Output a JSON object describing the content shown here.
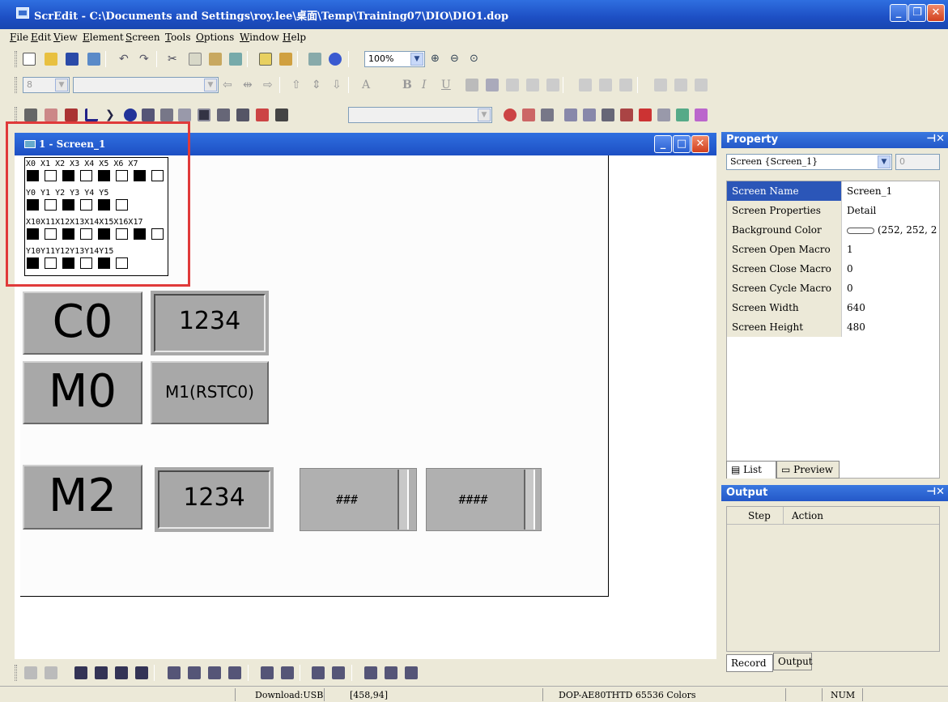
{
  "window": {
    "title": "ScrEdit - C:\\Documents and Settings\\roy.lee\\桌面\\Temp\\Training07\\DIO\\DIO1.dop"
  },
  "menu": [
    "File",
    "Edit",
    "View",
    "Element",
    "Screen",
    "Tools",
    "Options",
    "Window",
    "Help"
  ],
  "toolbar": {
    "zoom_value": "100%",
    "font_size_value": "8"
  },
  "child_window": {
    "title": "1 - Screen_1"
  },
  "io_panel": {
    "row1_labels": "X0 X1 X2 X3 X4 X5 X6 X7",
    "row1_states": [
      true,
      false,
      true,
      false,
      true,
      false,
      true,
      false
    ],
    "row2_labels": "Y0 Y1 Y2 Y3 Y4 Y5",
    "row2_states": [
      true,
      false,
      true,
      false,
      true,
      false
    ],
    "row3_labels": "X10X11X12X13X14X15X16X17",
    "row3_states": [
      true,
      false,
      true,
      false,
      true,
      false,
      true,
      false
    ],
    "row4_labels": "Y10Y11Y12Y13Y14Y15",
    "row4_states": [
      true,
      false,
      true,
      false,
      true,
      false
    ]
  },
  "screen_elements": {
    "c0_label": "C0",
    "num1_value": "1234",
    "m0_label": "M0",
    "m1_label": "M1(RSTC0)",
    "m2_label": "M2",
    "num2_value": "1234",
    "hash1": "###",
    "hash2": "####"
  },
  "property_panel": {
    "title": "Property",
    "selector_value": "Screen {Screen_1}",
    "spin_value": "0",
    "rows": [
      {
        "key": "Screen Name",
        "value": "Screen_1"
      },
      {
        "key": "Screen Properties",
        "value": "Detail"
      },
      {
        "key": "Background Color",
        "value": "(252, 252, 2"
      },
      {
        "key": "Screen Open Macro",
        "value": "1"
      },
      {
        "key": "Screen Close Macro",
        "value": "0"
      },
      {
        "key": "Screen Cycle Macro",
        "value": "0"
      },
      {
        "key": "Screen Width",
        "value": "640"
      },
      {
        "key": "Screen Height",
        "value": "480"
      }
    ],
    "tab_list": "List",
    "tab_preview": "Preview"
  },
  "output_panel": {
    "title": "Output",
    "col_step": "Step",
    "col_action": "Action",
    "tab_record": "Record",
    "tab_output": "Output"
  },
  "status": {
    "download": "Download:USB",
    "coords": "[458,94]",
    "device": "DOP-AE80THTD 65536 Colors",
    "num": "NUM"
  }
}
